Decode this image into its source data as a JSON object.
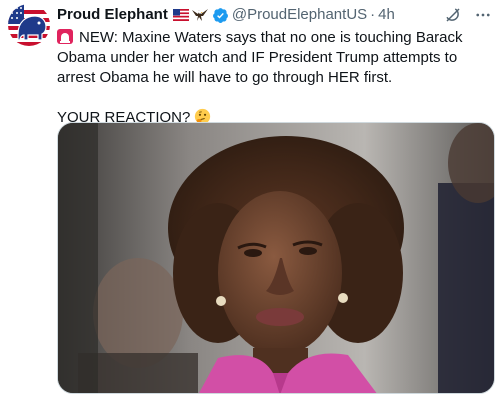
{
  "author": {
    "display_name": "Proud Elephant",
    "handle": "@ProudElephantUS",
    "separator": "·",
    "time": "4h"
  },
  "tweet": {
    "line1": "NEW: Maxine Waters says that no one is touching Barack Obama under her watch and IF President Trump attempts to arrest Obama he will have to go through HER first.",
    "question": "YOUR REACTION?"
  },
  "icons": {
    "avatar": "elephant-flag-avatar",
    "flags": [
      "us-flag-emoji",
      "eagle-emoji"
    ],
    "verified": "verified-badge-icon",
    "grok": "grok-icon",
    "more": "more-icon",
    "siren": "rotating-light-emoji",
    "thinking": "thinking-face-emoji"
  },
  "colors": {
    "verified_blue": "#1d9bf0",
    "secondary_text": "#536471",
    "jacket_pink": "#d24fa6"
  }
}
